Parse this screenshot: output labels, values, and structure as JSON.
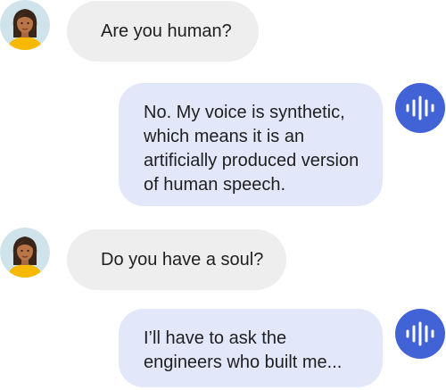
{
  "conversation": {
    "messages": [
      {
        "role": "user",
        "lines": [
          "Are you human?"
        ]
      },
      {
        "role": "assistant",
        "lines": [
          "No. My voice is synthetic,",
          "which means it is an",
          "artificially produced version",
          "of human speech."
        ]
      },
      {
        "role": "user",
        "lines": [
          "Do you have a soul?"
        ]
      },
      {
        "role": "assistant",
        "lines": [
          "I’ll have to ask the",
          "engineers who built me..."
        ]
      }
    ]
  },
  "colors": {
    "user_bubble": "#eeeeee",
    "assistant_bubble": "#e2e8fa",
    "assistant_icon": "#4263d6",
    "avatar_background": "#cfe3ea",
    "avatar_shirt": "#f7b800"
  },
  "icons": {
    "user_avatar": "woman-avatar-icon",
    "assistant": "voice-waveform-icon"
  }
}
